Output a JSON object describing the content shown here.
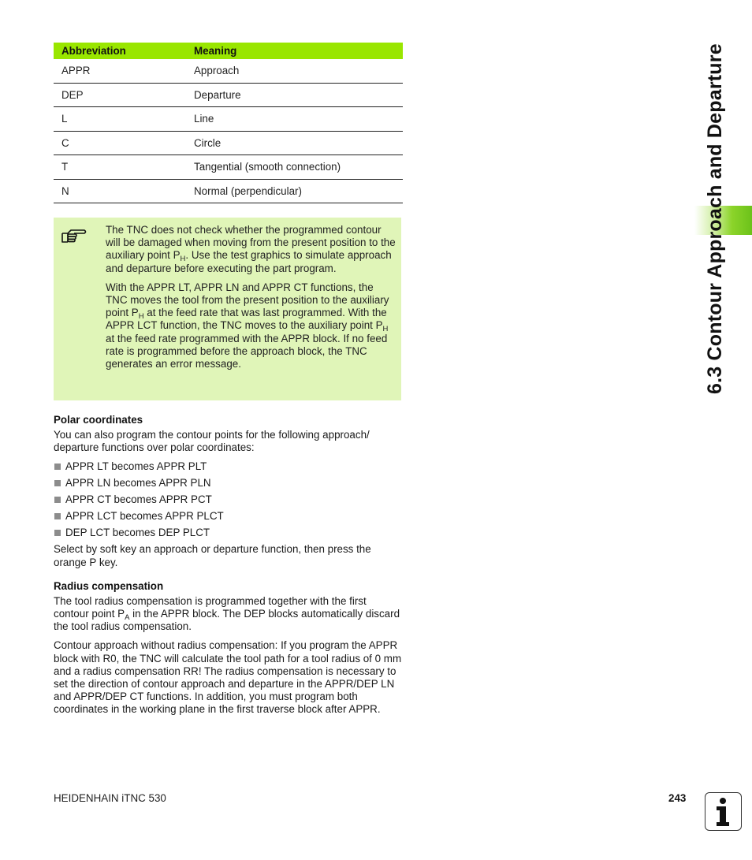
{
  "table": {
    "headers": [
      "Abbreviation",
      "Meaning"
    ],
    "rows": [
      [
        "APPR",
        "Approach"
      ],
      [
        "DEP",
        "Departure"
      ],
      [
        "L",
        "Line"
      ],
      [
        "C",
        "Circle"
      ],
      [
        "T",
        "Tangential (smooth connection)"
      ],
      [
        "N",
        "Normal (perpendicular)"
      ]
    ]
  },
  "note": {
    "icon": "pointing-hand-icon",
    "p1_a": "The TNC does not check whether the programmed contour will be damaged when moving from the present position to the auxiliary point P",
    "p1_sub": "H",
    "p1_b": ". Use the test graphics to simulate approach and departure before executing the part program.",
    "p2_a": "With the APPR LT, APPR LN and APPR CT functions, the TNC moves the tool from the present position to the auxiliary point P",
    "p2_sub1": "H",
    "p2_b": " at the feed rate that was last programmed. With the APPR LCT function, the TNC moves to the auxiliary point P",
    "p2_sub2": "H",
    "p2_c": " at the feed rate programmed with the APPR block. If no feed rate is programmed before the approach block, the TNC generates an error message."
  },
  "polar": {
    "heading": "Polar coordinates",
    "intro": "You can also program the contour points for the following approach/ departure functions over polar coordinates:",
    "items": [
      "APPR LT becomes APPR PLT",
      "APPR LN becomes APPR PLN",
      "APPR CT becomes APPR PCT",
      "APPR LCT becomes APPR PLCT",
      "DEP LCT becomes DEP PLCT"
    ],
    "outro": "Select by soft key an approach or departure function, then press the orange P key."
  },
  "radius": {
    "heading": "Radius compensation",
    "p1_a": "The tool radius compensation is programmed together with the first contour point P",
    "p1_sub": "A",
    "p1_b": " in the APPR block. The DEP blocks automatically discard the tool radius compensation.",
    "p2": "Contour approach without radius compensation: If you program the APPR block with R0, the TNC will calculate the tool path for a tool radius of 0 mm and a radius compensation RR! The radius compensation is necessary to set the direction of contour approach and departure in the APPR/DEP LN and APPR/DEP CT functions. In addition, you must program both coordinates in the working plane in the first traverse block after APPR."
  },
  "side_tab": {
    "title": "6.3 Contour Approach and Departure"
  },
  "footer": {
    "manual": "HEIDENHAIN iTNC 530",
    "page": "243",
    "icon": "info-icon"
  },
  "colors": {
    "accent_green": "#99e600",
    "note_bg": "#e0f5b8"
  }
}
